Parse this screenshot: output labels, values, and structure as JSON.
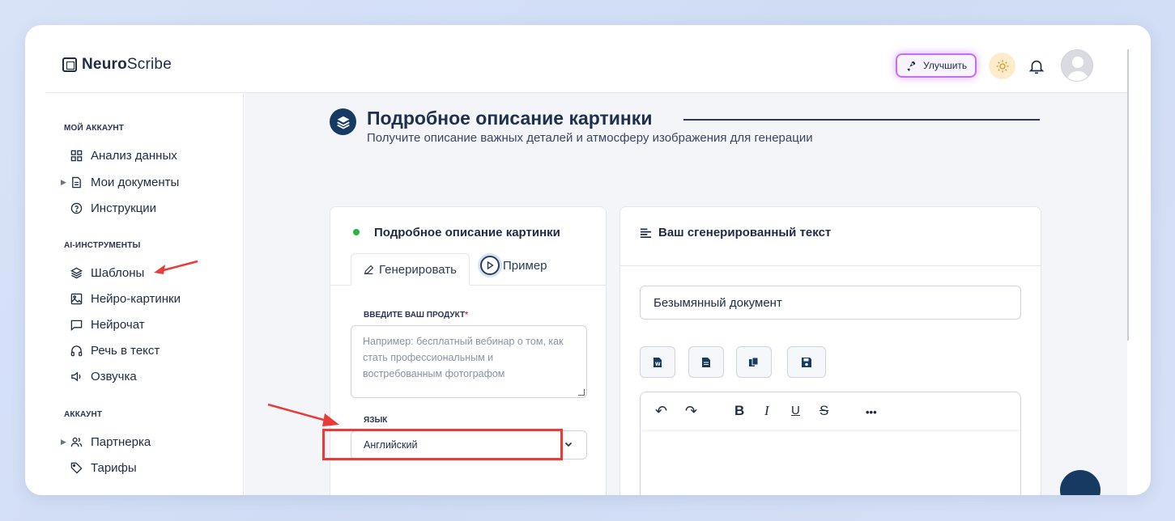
{
  "app": {
    "brand_bold": "Neuro",
    "brand_rest": "Scribe"
  },
  "header": {
    "upgrade_label": "Улучшить"
  },
  "sidebar": {
    "sections": [
      {
        "title": "МОЙ АККАУНТ",
        "items": [
          {
            "label": "Анализ данных",
            "icon": "grid-icon"
          },
          {
            "label": "Мои документы",
            "icon": "document-icon",
            "expandable": true
          },
          {
            "label": "Инструкции",
            "icon": "help-circle-icon"
          }
        ]
      },
      {
        "title": "AI-ИНСТРУМЕНТЫ",
        "items": [
          {
            "label": "Шаблоны",
            "icon": "layers-icon"
          },
          {
            "label": "Нейро-картинки",
            "icon": "image-icon"
          },
          {
            "label": "Нейрочат",
            "icon": "chat-icon"
          },
          {
            "label": "Речь в текст",
            "icon": "headphones-icon"
          },
          {
            "label": "Озвучка",
            "icon": "speaker-icon"
          }
        ]
      },
      {
        "title": "АККАУНТ",
        "items": [
          {
            "label": "Партнерка",
            "icon": "users-icon",
            "expandable": true
          },
          {
            "label": "Тарифы",
            "icon": "tag-icon"
          }
        ]
      }
    ]
  },
  "page": {
    "title": "Подробное описание картинки",
    "subtitle": "Получите описание важных деталей и атмосферу изображения для генерации"
  },
  "left_card": {
    "title": "Подробное описание картинки",
    "tabs": [
      {
        "label": "Генерировать",
        "active": true
      },
      {
        "label": "Пример",
        "active": false
      }
    ],
    "product_label": "ВВЕДИТЕ ВАШ ПРОДУКТ",
    "product_required_mark": "*",
    "product_placeholder": "Например: бесплатный вебинар о том, как стать профессиональным и востребованным фотографом",
    "language_label": "ЯЗЫК",
    "language_value": "Английский"
  },
  "right_card": {
    "title": "Ваш сгенерированный текст",
    "document_name": "Безымянный документ",
    "toolbar_icons": [
      "word-export-icon",
      "document-export-icon",
      "copy-icon",
      "save-icon"
    ],
    "editor_tools": {
      "undo": "↶",
      "redo": "↷",
      "bold": "B",
      "italic": "I",
      "underline": "U",
      "strike": "S",
      "more": "•••"
    }
  },
  "colors": {
    "accent": "#173a63",
    "highlight": "#ea3b3b",
    "status": "#27b33d"
  }
}
